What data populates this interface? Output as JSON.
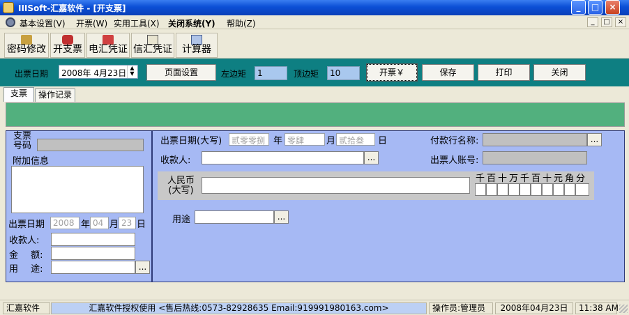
{
  "window": {
    "title": "IIISoft-汇嘉软件 - [开支票]",
    "controls": [
      "_",
      "□",
      "×"
    ]
  },
  "menu": {
    "items": [
      "基本设置(V)",
      "开票(W)",
      "实用工具(X)",
      "关闭系统(Y)",
      "帮助(Z)"
    ],
    "mdi_controls": [
      "_",
      "□",
      "×"
    ]
  },
  "toolbar": {
    "buttons": [
      {
        "label": "密码修改",
        "icon": "key-icon"
      },
      {
        "label": "开支票",
        "icon": "people-icon"
      },
      {
        "label": "电汇凭证",
        "icon": "money-icon"
      },
      {
        "label": "信汇凭证",
        "icon": "letter-icon"
      },
      {
        "label": "计算器",
        "icon": "calculator-icon"
      }
    ]
  },
  "controlbar": {
    "date_label": "出票日期",
    "date_value": "2008年 4月23日",
    "page_setup": "页面设置",
    "left_margin_label": "左边矩",
    "left_margin_value": "1",
    "top_margin_label": "顶边矩",
    "top_margin_value": "10",
    "issue_button": "开票￥",
    "save_button": "保存",
    "print_button": "打印",
    "close_button": "关闭"
  },
  "tabs": [
    "支票",
    "操作记录"
  ],
  "left": {
    "cheque_label_1": "支票",
    "cheque_label_2": "号码",
    "extra_info_label": "附加信息",
    "date_label": "出票日期",
    "year": "2008",
    "year_suffix": "年",
    "month": "04",
    "month_suffix": "月",
    "day": "23",
    "day_suffix": "日",
    "payee_label": "收款人:",
    "amount_label_1": "金",
    "amount_label_2": "额:",
    "purpose_label_1": "用",
    "purpose_label_2": "途:",
    "dots": "..."
  },
  "right": {
    "date_big_label": "出票日期(大写)",
    "year_big": "贰零零捌",
    "year_suffix": "年",
    "month_big": "零肆",
    "month_suffix": "月",
    "day_big": "贰拾叁",
    "day_suffix": "日",
    "bank_label": "付款行名称:",
    "payee_label": "收款人:",
    "drawer_account_label": "出票人账号:",
    "rmb_label_1": "人民币",
    "rmb_label_2": "(大写)",
    "digit_header": "千百十万千百十元角分",
    "purpose_label": "用途",
    "dots": "..."
  },
  "status": {
    "app": "汇嘉软件",
    "license": "汇嘉软件授权使用 <售后热线:0573-82928635 Email:919991980163.com>",
    "operator": "操作员:管理员",
    "date": "2008年04月23日",
    "time": "11:38 AM"
  }
}
